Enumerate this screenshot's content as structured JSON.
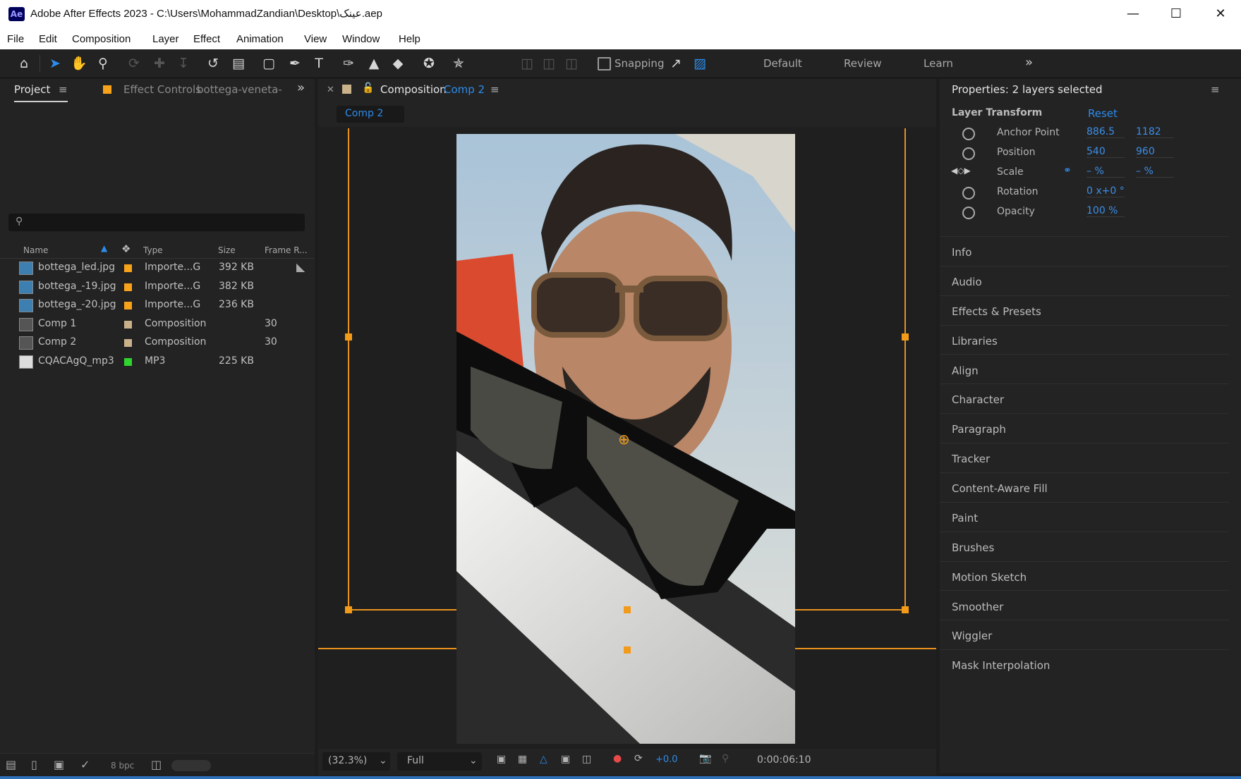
{
  "window": {
    "app_icon": "Ae",
    "title": "Adobe After Effects 2023 - C:\\Users\\MohammadZandian\\Desktop\\عینک.aep",
    "controls": [
      "minimize-icon",
      "maximize-icon",
      "close-icon"
    ]
  },
  "menu": [
    "File",
    "Edit",
    "Composition",
    "Layer",
    "Effect",
    "Animation",
    "View",
    "Window",
    "Help"
  ],
  "toolbar": {
    "tools": [
      "home-icon",
      "selection-tool-icon",
      "hand-tool-icon",
      "zoom-tool-icon",
      "orbit-camera-icon",
      "pan-camera-icon",
      "dolly-camera-icon",
      "rotation-tool-icon",
      "pan-behind-icon",
      "rectangle-tool-icon",
      "pen-tool-icon",
      "type-tool-icon",
      "brush-tool-icon",
      "clone-stamp-icon",
      "eraser-tool-icon",
      "roto-brush-icon",
      "puppet-pin-icon"
    ],
    "snapping_label": "Snapping",
    "workspaces": [
      "Default",
      "Review",
      "Learn"
    ],
    "overflow": "»"
  },
  "project_panel": {
    "tab_label": "Project",
    "effect_controls_label": "Effect Controls",
    "effect_controls_target": "bottega-veneta-",
    "overflow": "»",
    "search_placeholder": "",
    "columns": [
      "Name",
      "Type",
      "Size",
      "Frame R..."
    ],
    "items": [
      {
        "name": "bottega_led.jpg",
        "type": "Importe...G",
        "size": "392 KB",
        "frame_rate": "",
        "label_color": "#f7a21b",
        "icon": "image-footage-icon"
      },
      {
        "name": "bottega_-19.jpg",
        "type": "Importe...G",
        "size": "382 KB",
        "frame_rate": "",
        "label_color": "#f7a21b",
        "icon": "image-footage-icon"
      },
      {
        "name": "bottega_-20.jpg",
        "type": "Importe...G",
        "size": "236 KB",
        "frame_rate": "",
        "label_color": "#f7a21b",
        "icon": "image-footage-icon"
      },
      {
        "name": "Comp 1",
        "type": "Composition",
        "size": "",
        "frame_rate": "30",
        "label_color": "#c9b28a",
        "icon": "composition-icon"
      },
      {
        "name": "Comp 2",
        "type": "Composition",
        "size": "",
        "frame_rate": "30",
        "label_color": "#c9b28a",
        "icon": "composition-icon"
      },
      {
        "name": "CQACAgQ_mp3",
        "type": "MP3",
        "size": "225 KB",
        "frame_rate": "",
        "label_color": "#2fd42f",
        "icon": "audio-file-icon"
      }
    ],
    "footer": {
      "bpc": "8 bpc"
    }
  },
  "composition_panel": {
    "tab_prefix": "Composition",
    "tab_comp": "Comp 2",
    "breadcrumb": "Comp 2",
    "zoom": "(32.3%)",
    "resolution": "Full",
    "exposure": "+0.0",
    "timecode": "0:00:06:10"
  },
  "properties_panel": {
    "title": "Properties: 2 layers selected",
    "section": "Layer Transform",
    "reset": "Reset",
    "rows": [
      {
        "label": "Anchor Point",
        "v1": "886.5",
        "v2": "1182"
      },
      {
        "label": "Position",
        "v1": "540",
        "v2": "960"
      },
      {
        "label": "Scale",
        "v1": "– %",
        "v2": "– %"
      },
      {
        "label": "Rotation",
        "v1": "0 x+0 °",
        "v2": ""
      },
      {
        "label": "Opacity",
        "v1": "100 %",
        "v2": ""
      }
    ],
    "panels": [
      "Info",
      "Audio",
      "Effects & Presets",
      "Libraries",
      "Align",
      "Character",
      "Paragraph",
      "Tracker",
      "Content-Aware Fill",
      "Paint",
      "Brushes",
      "Motion Sketch",
      "Smoother",
      "Wiggler",
      "Mask Interpolation"
    ]
  },
  "colors": {
    "accent": "#2d8ceb",
    "layer_outline": "#e8911d",
    "app_bg": "#1d1d1d"
  }
}
